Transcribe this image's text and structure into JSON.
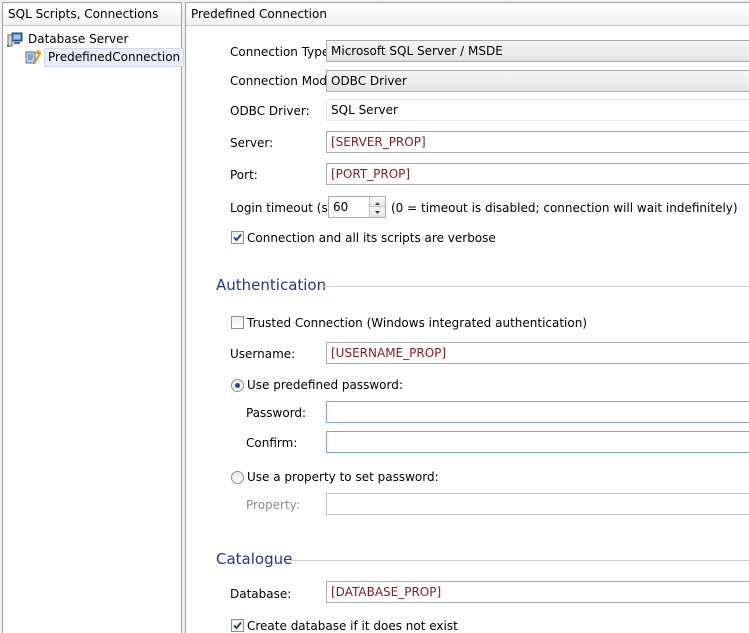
{
  "tree": {
    "header": "SQL Scripts, Connections",
    "nodes": [
      {
        "label": "Database Server",
        "icon": "database-server-icon"
      },
      {
        "label": "PredefinedConnection",
        "icon": "connection-icon",
        "selected": true
      }
    ]
  },
  "form": {
    "header": "Predefined Connection",
    "connection_type": {
      "label": "Connection Type:",
      "value": "Microsoft SQL Server / MSDE"
    },
    "connection_mode": {
      "label": "Connection Mode:",
      "value": "ODBC Driver"
    },
    "odbc_driver": {
      "label": "ODBC Driver:",
      "value": "SQL Server"
    },
    "server": {
      "label": "Server:",
      "value": "[SERVER_PROP]"
    },
    "port": {
      "label": "Port:",
      "value": "[PORT_PROP]"
    },
    "login_timeout": {
      "label": "Login timeout (sec):",
      "value": "60",
      "hint": "(0 = timeout is disabled; connection will wait indefinitely)"
    },
    "verbose": {
      "label": "Connection and all its scripts are verbose",
      "checked": true
    },
    "authentication": {
      "title": "Authentication",
      "trusted": {
        "label": "Trusted Connection (Windows integrated authentication)",
        "checked": false
      },
      "username": {
        "label": "Username:",
        "value": "[USERNAME_PROP]"
      },
      "use_predefined": {
        "label": "Use predefined password:",
        "selected": true
      },
      "password": {
        "label": "Password:",
        "value": ""
      },
      "confirm": {
        "label": "Confirm:",
        "value": ""
      },
      "use_property": {
        "label": "Use a property to set password:",
        "selected": false
      },
      "property": {
        "label": "Property:",
        "value": ""
      }
    },
    "catalogue": {
      "title": "Catalogue",
      "database": {
        "label": "Database:",
        "value": "[DATABASE_PROP]"
      },
      "create_db": {
        "label": "Create database if it does not exist",
        "checked": true
      }
    }
  },
  "colors": {
    "accent": "#1e3a8a",
    "property_text": "#8b1a1a"
  }
}
